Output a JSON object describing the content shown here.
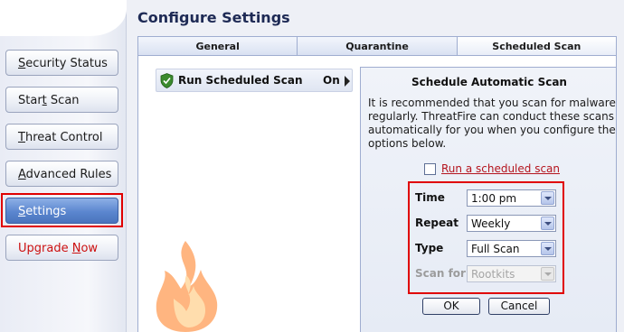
{
  "header": {
    "title": "Configure Settings"
  },
  "sidebar": {
    "items": [
      {
        "label": "Security Status",
        "ul": "S",
        "rest": "ecurity Status"
      },
      {
        "label": "Start Scan",
        "pre": "Star",
        "ul": "t",
        "rest": " Scan"
      },
      {
        "label": "Threat Control",
        "ul": "T",
        "rest": "hreat Control"
      },
      {
        "label": "Advanced Rules",
        "ul": "A",
        "rest": "dvanced Rules"
      },
      {
        "label": "Settings",
        "ul": "S",
        "rest": "ettings"
      },
      {
        "label": "Upgrade Now",
        "pre": "Upgrade ",
        "ul": "N",
        "rest": "ow"
      }
    ],
    "active_index": 4
  },
  "tabs": [
    {
      "label": "General"
    },
    {
      "label": "Quarantine"
    },
    {
      "label": "Scheduled Scan"
    }
  ],
  "list_item": {
    "label": "Run Scheduled Scan",
    "value": "On"
  },
  "panel": {
    "title": "Schedule Automatic Scan",
    "description": "It is recommended that you scan for malware regularly. ThreatFire can conduct these scans automatically for you when you configure the options below.",
    "checkbox_label": "Run a scheduled scan",
    "checkbox_checked": false,
    "fields": {
      "time": {
        "label": "Time",
        "value": "1:00 pm"
      },
      "repeat": {
        "label": "Repeat",
        "value": "Weekly"
      },
      "type": {
        "label": "Type",
        "value": "Full Scan"
      },
      "scan_for": {
        "label": "Scan for",
        "value": "Rootkits",
        "disabled": true
      }
    },
    "ok_label": "OK",
    "cancel_label": "Cancel"
  },
  "colors": {
    "accent": "#5b86cf",
    "highlight_outline": "#e00000",
    "link_red": "#b4141e",
    "title_navy": "#1e2a55"
  }
}
